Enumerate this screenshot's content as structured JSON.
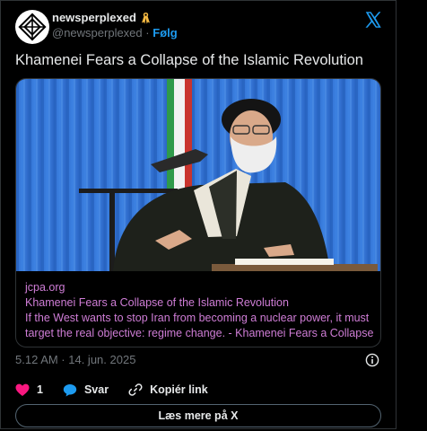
{
  "post": {
    "display_name": "newsperplexed",
    "handle": "@newsperplexed",
    "separator": "·",
    "follow_label": "Følg",
    "text": "Khamenei Fears a Collapse of the Islamic Revolution",
    "timestamp": "5.12 AM · 14. jun. 2025"
  },
  "card": {
    "domain": "jcpa.org",
    "title": "Khamenei Fears a Collapse of the Islamic Revolution",
    "description_line1": "If the West wants to stop Iran from becoming a nuclear power, it must",
    "description_line2": "target the real objective: regime change. - Khamenei Fears a Collapse …"
  },
  "actions": {
    "like_count": "1",
    "reply_label": "Svar",
    "copy_link_label": "Kopiér link"
  },
  "learn_more_label": "Læs mere på X",
  "colors": {
    "background": "#000000",
    "accent": "#1d9bf0",
    "like": "#f91880",
    "link_text": "#cf7dd6",
    "muted": "#71767b"
  },
  "icons": [
    "avatar-logo-icon",
    "ribbon-icon",
    "x-logo-icon",
    "info-icon",
    "heart-icon",
    "reply-icon",
    "link-icon"
  ]
}
